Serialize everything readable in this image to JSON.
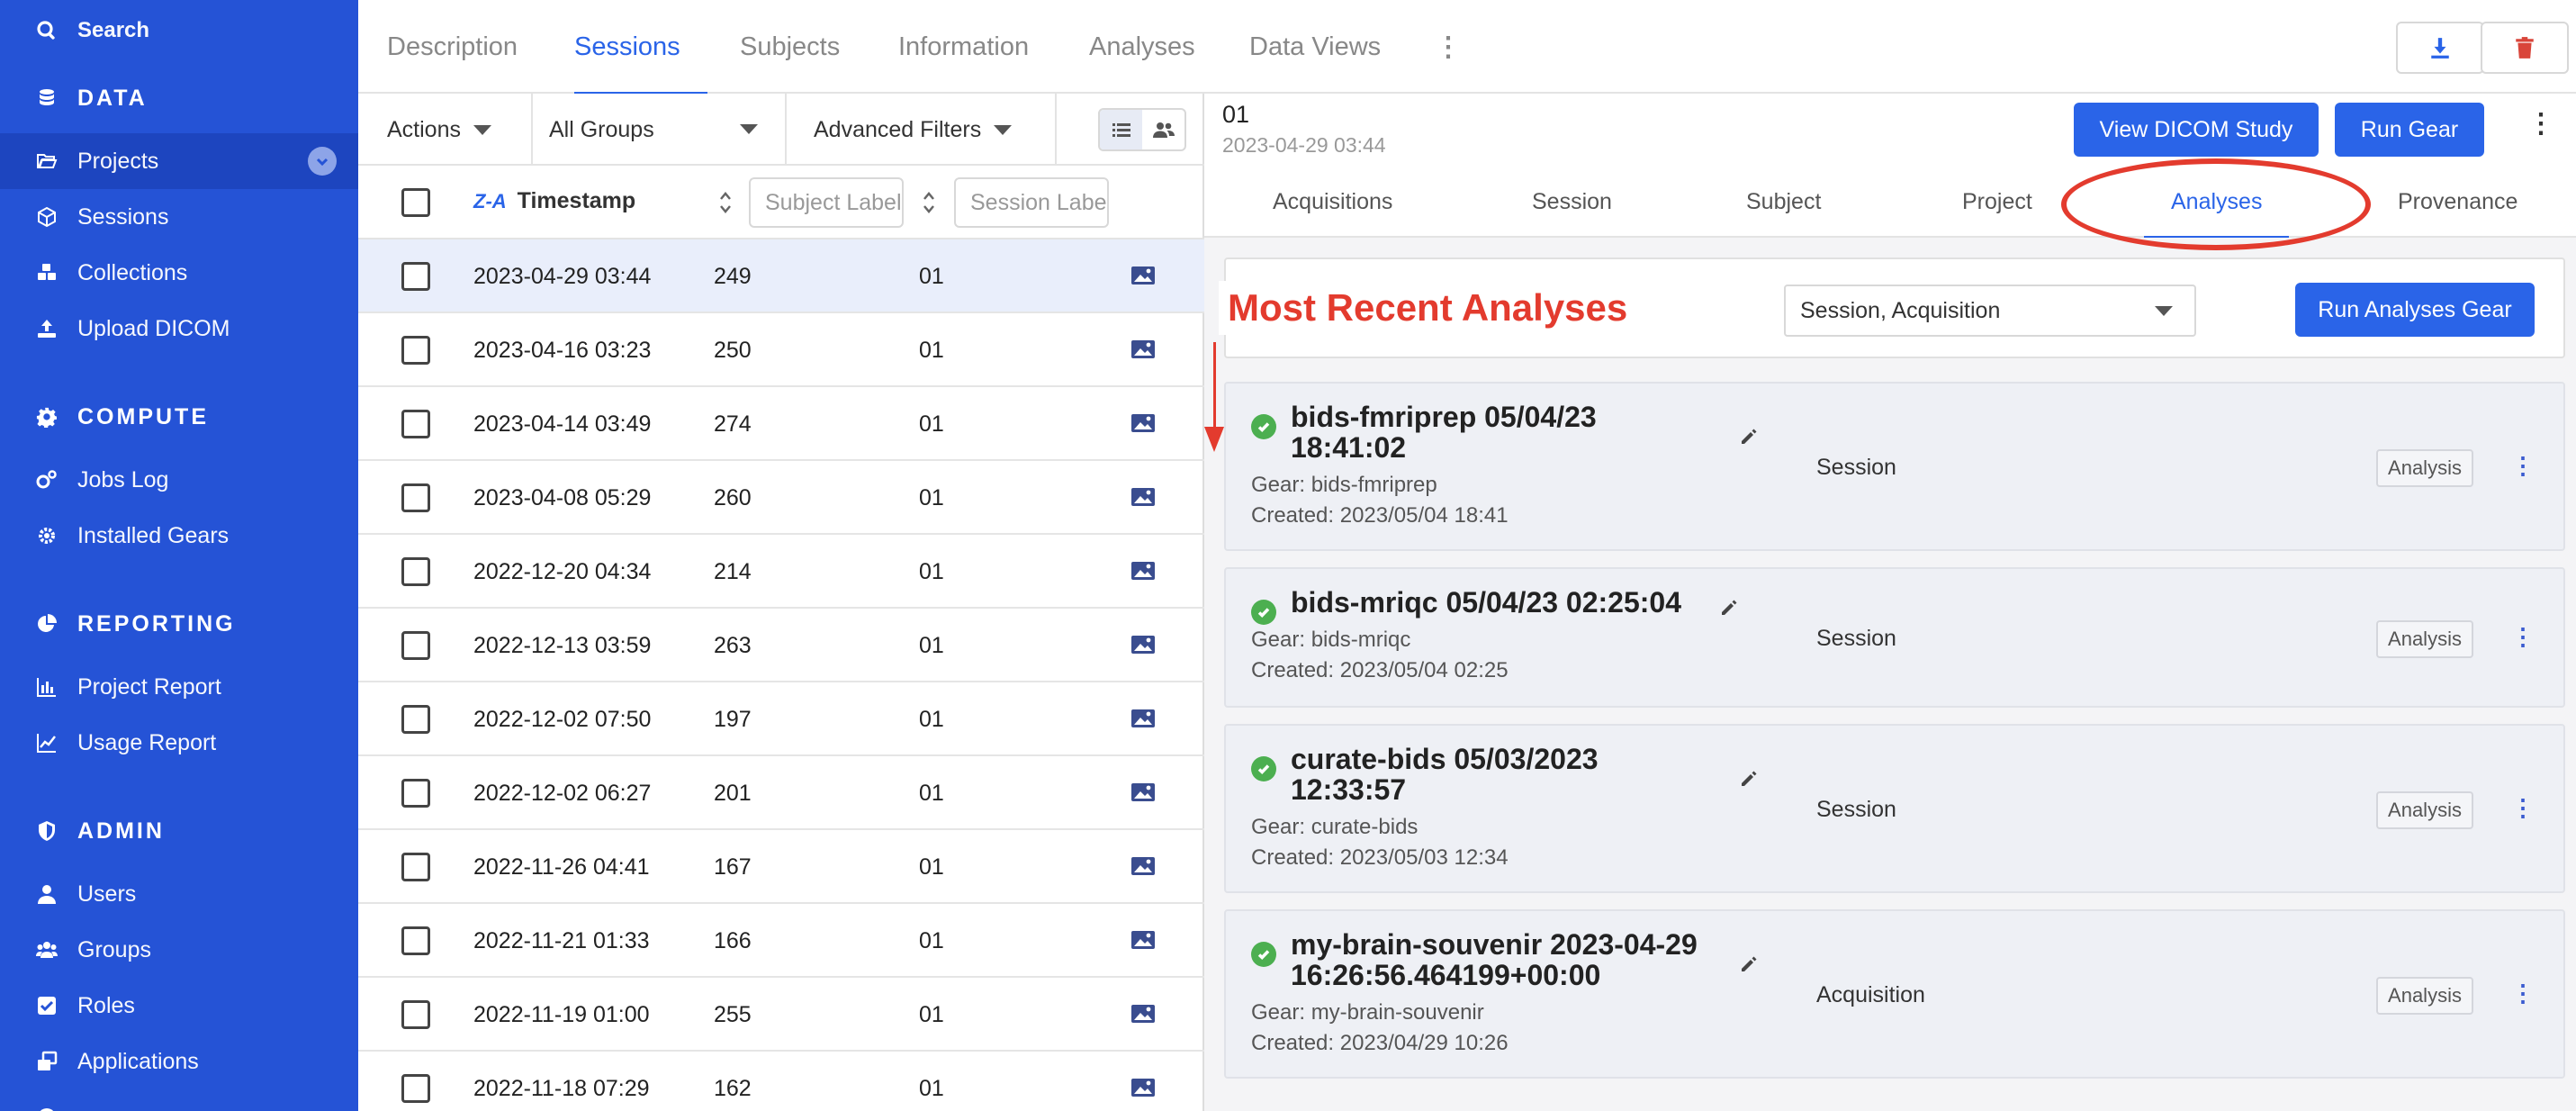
{
  "sidebar": {
    "search_label": "Search",
    "sections": {
      "data": "DATA",
      "compute": "COMPUTE",
      "reporting": "REPORTING",
      "admin": "ADMIN"
    },
    "items": {
      "projects": "Projects",
      "sessions": "Sessions",
      "collections": "Collections",
      "upload_dicom": "Upload DICOM",
      "jobs_log": "Jobs Log",
      "installed_gears": "Installed Gears",
      "project_report": "Project Report",
      "usage_report": "Usage Report",
      "users": "Users",
      "groups": "Groups",
      "roles": "Roles",
      "applications": "Applications"
    },
    "active_item": "projects",
    "colors": {
      "bg": "#2553d6",
      "active_bg": "#1d45bf"
    }
  },
  "top_tabs": {
    "items": [
      "Description",
      "Sessions",
      "Subjects",
      "Information",
      "Analyses",
      "Data Views"
    ],
    "active": "Sessions"
  },
  "toolbar": {
    "actions_label": "Actions",
    "group_select": "All Groups",
    "advanced_filters": "Advanced Filters"
  },
  "table": {
    "header": {
      "sort_icon": "Z-A",
      "timestamp": "Timestamp",
      "subject_placeholder": "Subject Label",
      "session_placeholder": "Session Label"
    },
    "rows": [
      {
        "timestamp": "2023-04-29 03:44",
        "subject": "249",
        "session": "01",
        "selected": true
      },
      {
        "timestamp": "2023-04-16 03:23",
        "subject": "250",
        "session": "01"
      },
      {
        "timestamp": "2023-04-14 03:49",
        "subject": "274",
        "session": "01"
      },
      {
        "timestamp": "2023-04-08 05:29",
        "subject": "260",
        "session": "01"
      },
      {
        "timestamp": "2022-12-20 04:34",
        "subject": "214",
        "session": "01"
      },
      {
        "timestamp": "2022-12-13 03:59",
        "subject": "263",
        "session": "01"
      },
      {
        "timestamp": "2022-12-02 07:50",
        "subject": "197",
        "session": "01"
      },
      {
        "timestamp": "2022-12-02 06:27",
        "subject": "201",
        "session": "01"
      },
      {
        "timestamp": "2022-11-26 04:41",
        "subject": "167",
        "session": "01"
      },
      {
        "timestamp": "2022-11-21 01:33",
        "subject": "166",
        "session": "01"
      },
      {
        "timestamp": "2022-11-19 01:00",
        "subject": "255",
        "session": "01"
      },
      {
        "timestamp": "2022-11-18 07:29",
        "subject": "162",
        "session": "01"
      }
    ]
  },
  "detail": {
    "session_id": "01",
    "session_date": "2023-04-29 03:44",
    "view_dicom_label": "View DICOM Study",
    "run_gear_label": "Run Gear",
    "tabs": [
      "Acquisitions",
      "Session",
      "Subject",
      "Project",
      "Analyses",
      "Provenance"
    ],
    "active_tab": "Analyses",
    "filter_select": "Session, Acquisition",
    "run_analyses_label": "Run Analyses Gear",
    "annotation": "Most Recent Analyses",
    "analyses": [
      {
        "title_line1": "bids-fmriprep 05/04/23",
        "title_line2": "18:41:02",
        "gear": "Gear: bids-fmriprep",
        "created": "Created: 2023/05/04 18:41",
        "container": "Session",
        "badge": "Analysis"
      },
      {
        "title_line1": "bids-mriqc 05/04/23 02:25:04",
        "title_line2": "",
        "gear": "Gear: bids-mriqc",
        "created": "Created: 2023/05/04 02:25",
        "container": "Session",
        "badge": "Analysis"
      },
      {
        "title_line1": "curate-bids 05/03/2023",
        "title_line2": "12:33:57",
        "gear": "Gear: curate-bids",
        "created": "Created: 2023/05/03 12:34",
        "container": "Session",
        "badge": "Analysis"
      },
      {
        "title_line1": "my-brain-souvenir 2023-04-29",
        "title_line2": "16:26:56.464199+00:00",
        "gear": "Gear: my-brain-souvenir",
        "created": "Created: 2023/04/29 10:26",
        "container": "Acquisition",
        "badge": "Analysis"
      }
    ],
    "colors": {
      "primary": "#2a64e8",
      "annotation": "#e33b2e",
      "success": "#4caf50"
    }
  }
}
